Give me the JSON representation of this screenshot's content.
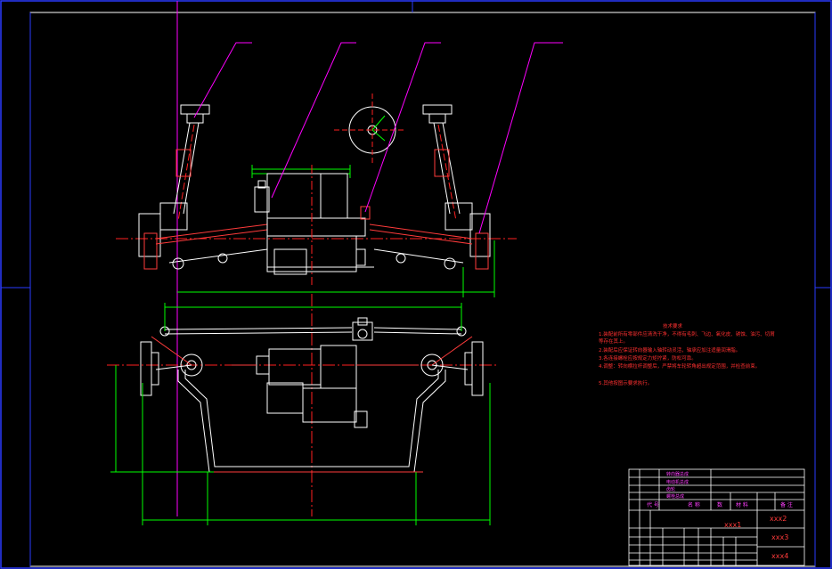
{
  "title_block": {
    "part_no_1": "xxx1",
    "part_no_2": "xxx2",
    "part_no_3": "xxx3",
    "part_no_4": "xxx4",
    "header_cols": [
      "代 号",
      "名 称",
      "数",
      "材 料",
      "备 注"
    ],
    "list_rows": [
      "转向器总成",
      "电动机总成",
      "齿轮",
      "螺栓总成"
    ]
  },
  "tech_notes": {
    "heading": "技术要求",
    "lines": [
      "1.装配前所有零部件应清洗干净，不得有毛刺、飞边、氧化皮、锈蚀、油污、切屑",
      "等存在其上。",
      "2.装配后应保证转向器输入轴转动灵活，轴承应加注适量润滑脂。",
      "3.各连接螺栓应按规定力矩拧紧，防松可靠。",
      "4.调整：转向横拉杆调整后，严禁将车轮转角超出规定范围，并检查前束。",
      "5.其他按图示要求执行。"
    ]
  },
  "colors": {
    "frame": "#2a3bff",
    "outline": "#ffffff",
    "part": "#ff3b3b",
    "centerline": "#ff2020",
    "dimension": "#00ff00",
    "leader": "#ff00ff",
    "annotation": "#ff3030",
    "block_text": "#ff40ff",
    "motor": "#00e0ff"
  }
}
